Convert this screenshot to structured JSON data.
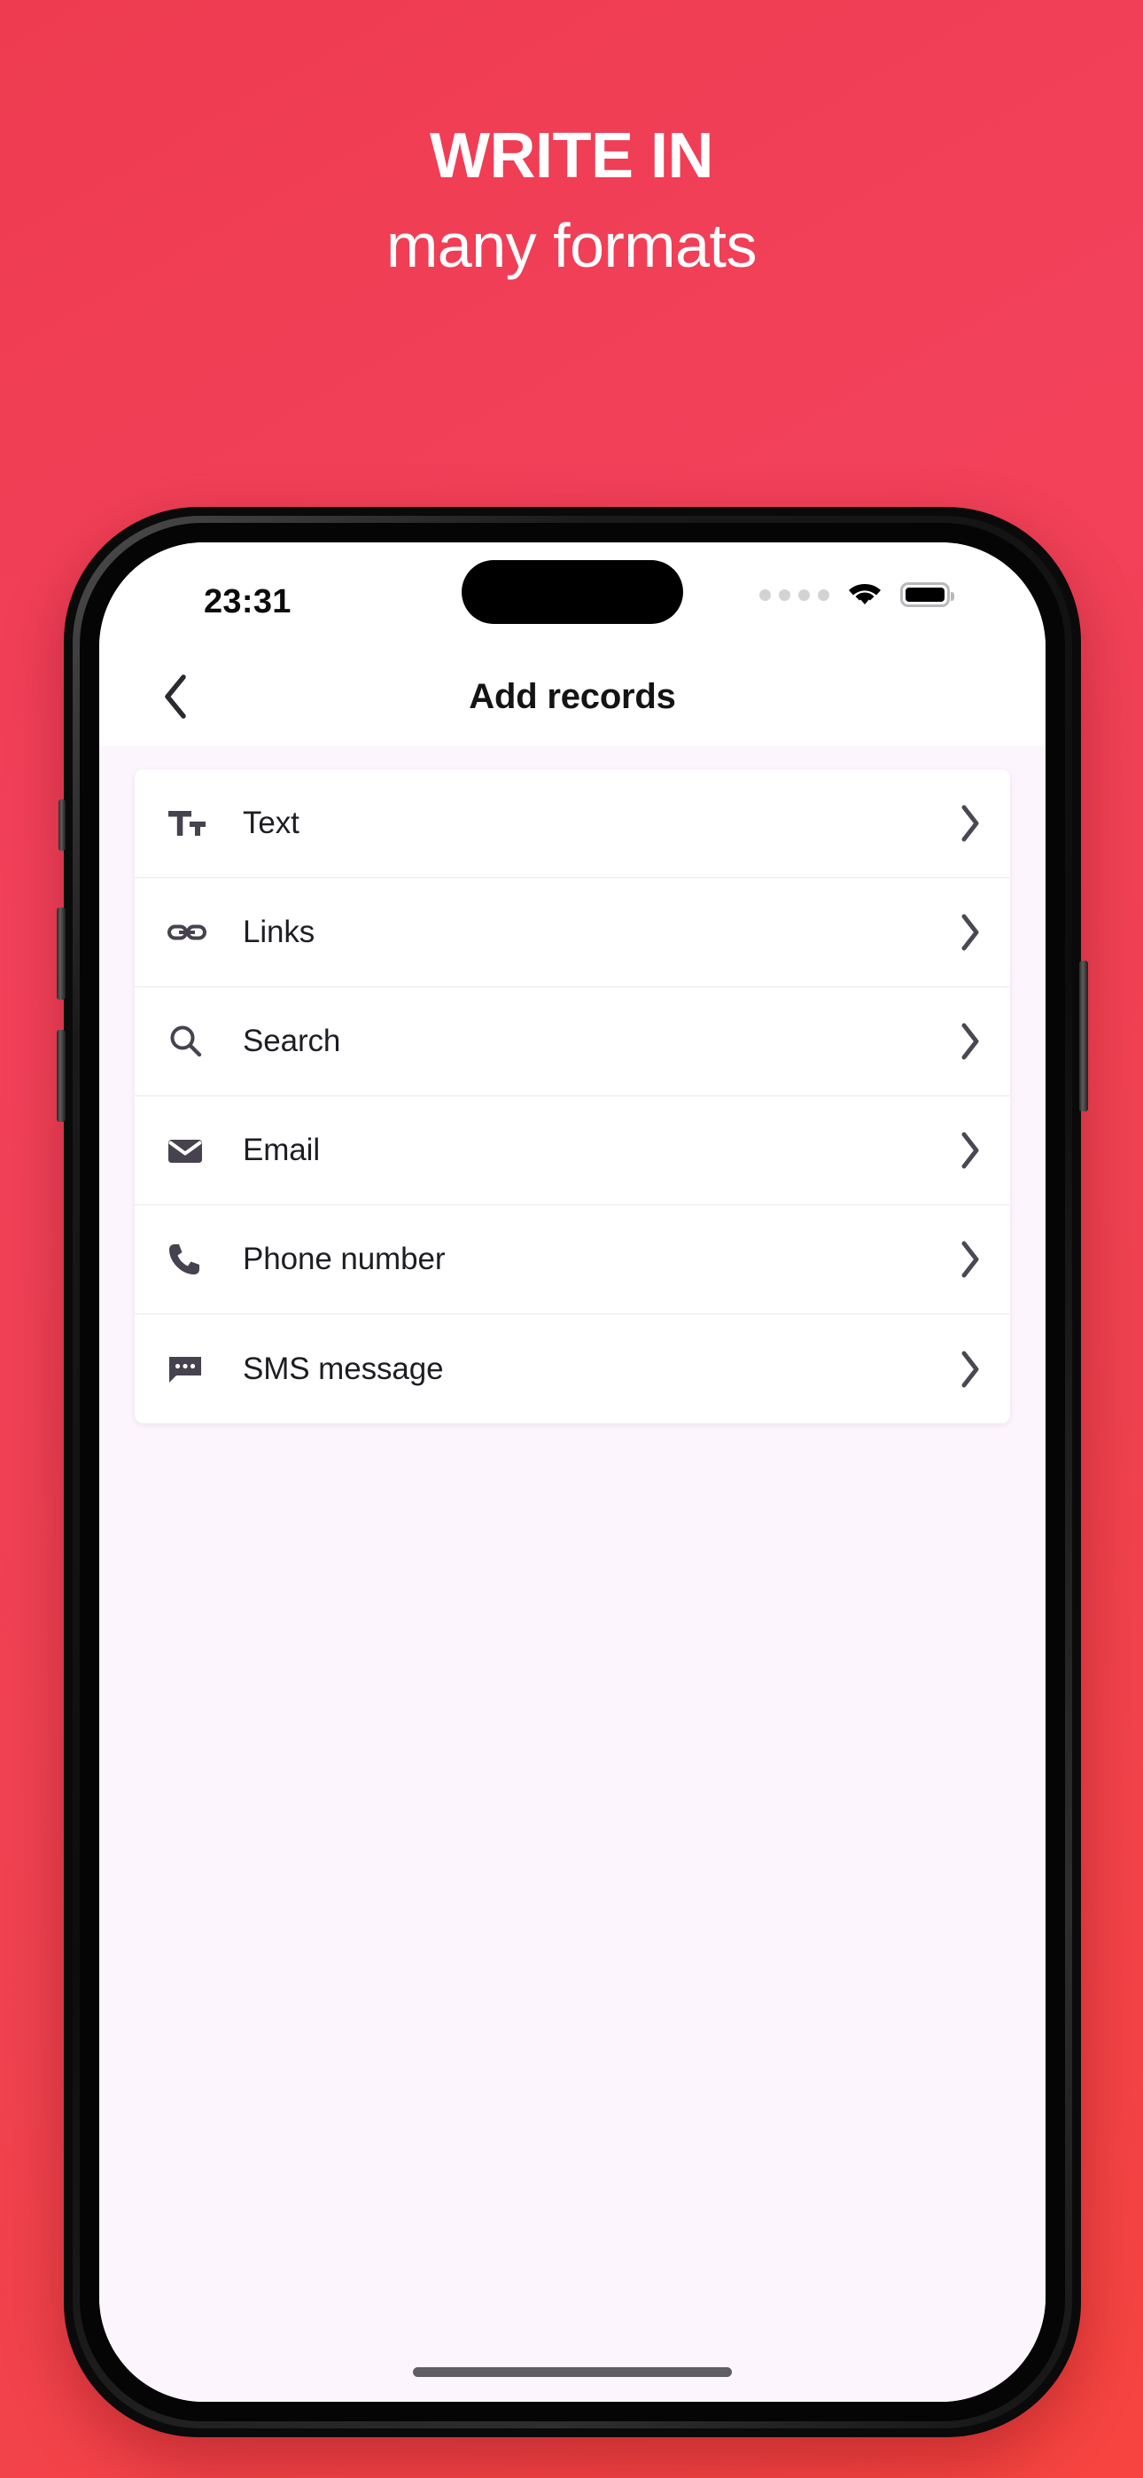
{
  "marketing": {
    "headline_line1": "WRITE IN",
    "headline_line2": "many formats",
    "background_color_start": "#EE3B50",
    "background_color_end": "#F74440",
    "text_color": "#FFFFFF"
  },
  "status_bar": {
    "time": "23:31",
    "signal_icon": "signal-dots-icon",
    "wifi_icon": "wifi-icon",
    "battery_icon": "battery-full-icon",
    "dynamic_island": "dynamic-island"
  },
  "nav_bar": {
    "back_icon": "chevron-left-icon",
    "title": "Add records"
  },
  "content": {
    "background_color": "#FDF5FD",
    "card_background": "#FFFFFF",
    "rows": [
      {
        "label": "Text",
        "icon": "text-format-icon",
        "chevron": "chevron-right-icon"
      },
      {
        "label": "Links",
        "icon": "link-icon",
        "chevron": "chevron-right-icon"
      },
      {
        "label": "Search",
        "icon": "search-icon",
        "chevron": "chevron-right-icon"
      },
      {
        "label": "Email",
        "icon": "email-icon",
        "chevron": "chevron-right-icon"
      },
      {
        "label": "Phone number",
        "icon": "phone-icon",
        "chevron": "chevron-right-icon"
      },
      {
        "label": "SMS message",
        "icon": "sms-icon",
        "chevron": "chevron-right-icon"
      }
    ]
  },
  "home_indicator": "home-indicator"
}
